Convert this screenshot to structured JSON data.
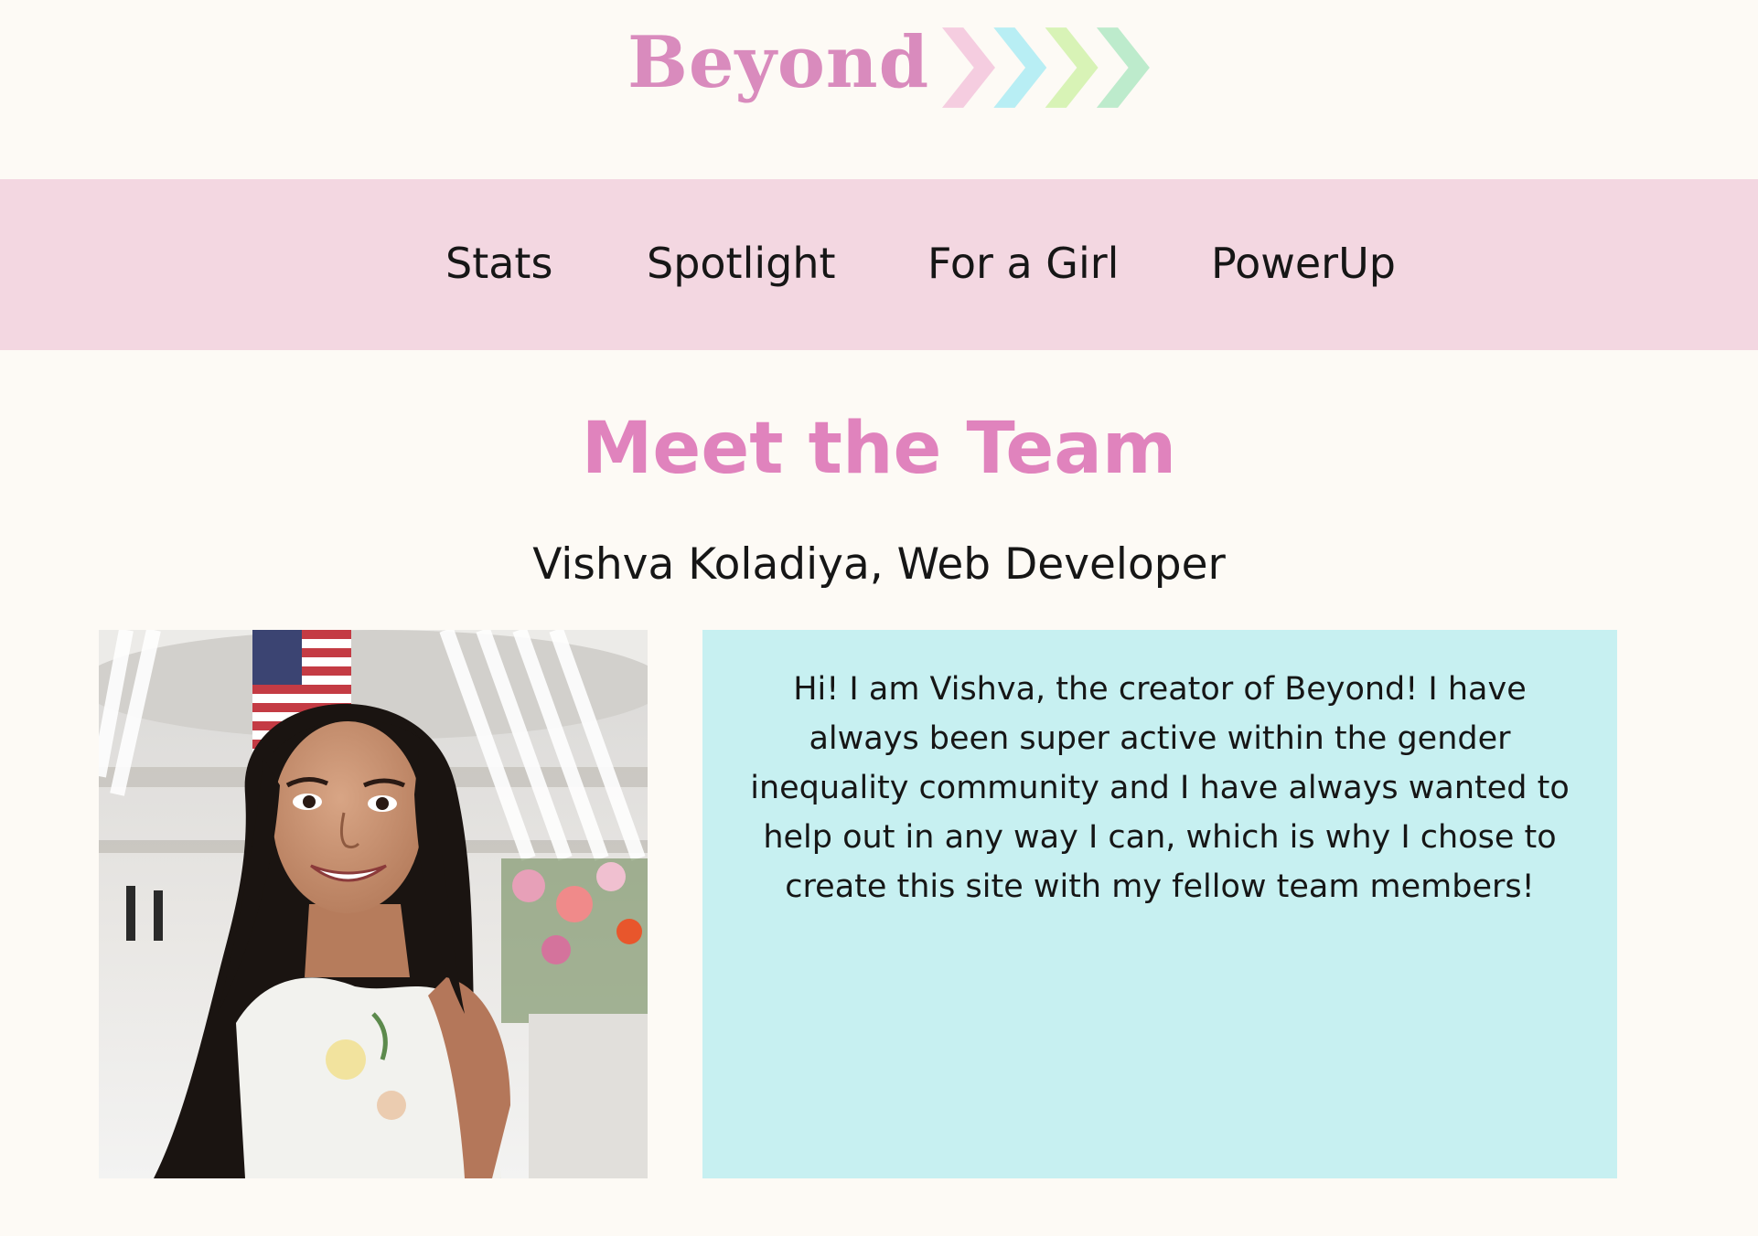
{
  "brand": {
    "name": "Beyond",
    "colors": {
      "word": "#d98bbd",
      "arrows": [
        "#f5cde0",
        "#b8eef4",
        "#d8f3b6",
        "#bdebcc"
      ]
    }
  },
  "nav": {
    "background": "#f3d7e1",
    "items": [
      {
        "label": "Stats"
      },
      {
        "label": "Spotlight"
      },
      {
        "label": "For a Girl"
      },
      {
        "label": "PowerUp"
      }
    ]
  },
  "main": {
    "title": "Meet the Team",
    "title_color": "#e083bd",
    "member": {
      "name_role": "Vishva Koladiya, Web Developer",
      "photo_alt": "Portrait photo of Vishva Koladiya",
      "bio": "Hi! I am Vishva, the creator of Beyond! I have always been super active within the gender inequality community and I have always wanted to help out in any way I can, which is why I chose to create this site with my fellow team members!",
      "bio_background": "#c7f0f1"
    }
  },
  "page_background": "#fdfaf5"
}
